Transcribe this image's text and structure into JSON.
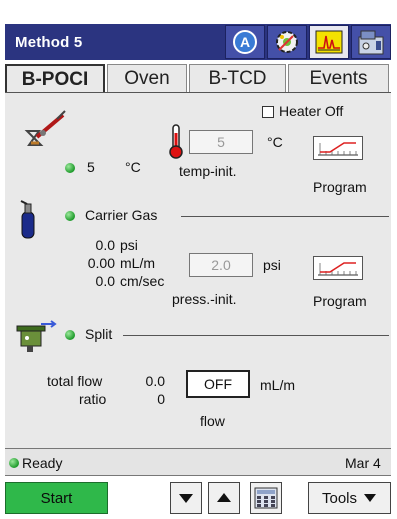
{
  "window": {
    "title": "Method 5",
    "toolbar_icons": [
      "autosampler-icon",
      "configuration-icon",
      "chromatogram-icon",
      "instrument-icon"
    ]
  },
  "tabs": [
    {
      "label": "B-POCI",
      "active": true
    },
    {
      "label": "Oven",
      "active": false
    },
    {
      "label": "B-TCD",
      "active": false
    },
    {
      "label": "Events",
      "active": false
    }
  ],
  "inlet": {
    "heater_off_label": "Heater Off",
    "heater_off_checked": false,
    "temp_actual": "5",
    "temp_unit": "°C",
    "temp_setpoint": "5",
    "temp_setpoint_unit": "°C",
    "temp_setpoint_label": "temp-init.",
    "program_label": "Program"
  },
  "carrier": {
    "label": "Carrier Gas",
    "pressure_value": "0.0",
    "pressure_unit": "psi",
    "flow_value": "0.00",
    "flow_unit": "mL/m",
    "velocity_value": "0.0",
    "velocity_unit": "cm/sec",
    "pressure_setpoint": "2.0",
    "pressure_setpoint_unit": "psi",
    "pressure_setpoint_label": "press.-init.",
    "program_label": "Program"
  },
  "split": {
    "label": "Split",
    "total_flow_label": "total flow",
    "total_flow_value": "0.0",
    "ratio_label": "ratio",
    "ratio_value": "0",
    "flow_value": "OFF",
    "flow_unit": "mL/m",
    "flow_label": "flow"
  },
  "status": {
    "text": "Ready",
    "date": "Mar 4"
  },
  "bottom": {
    "start_label": "Start",
    "tools_label": "Tools"
  },
  "colors": {
    "titlebar": "#2b3480",
    "panel": "#e9e9e9",
    "start": "#2fb84a",
    "indicator": "#1d9a2a"
  }
}
